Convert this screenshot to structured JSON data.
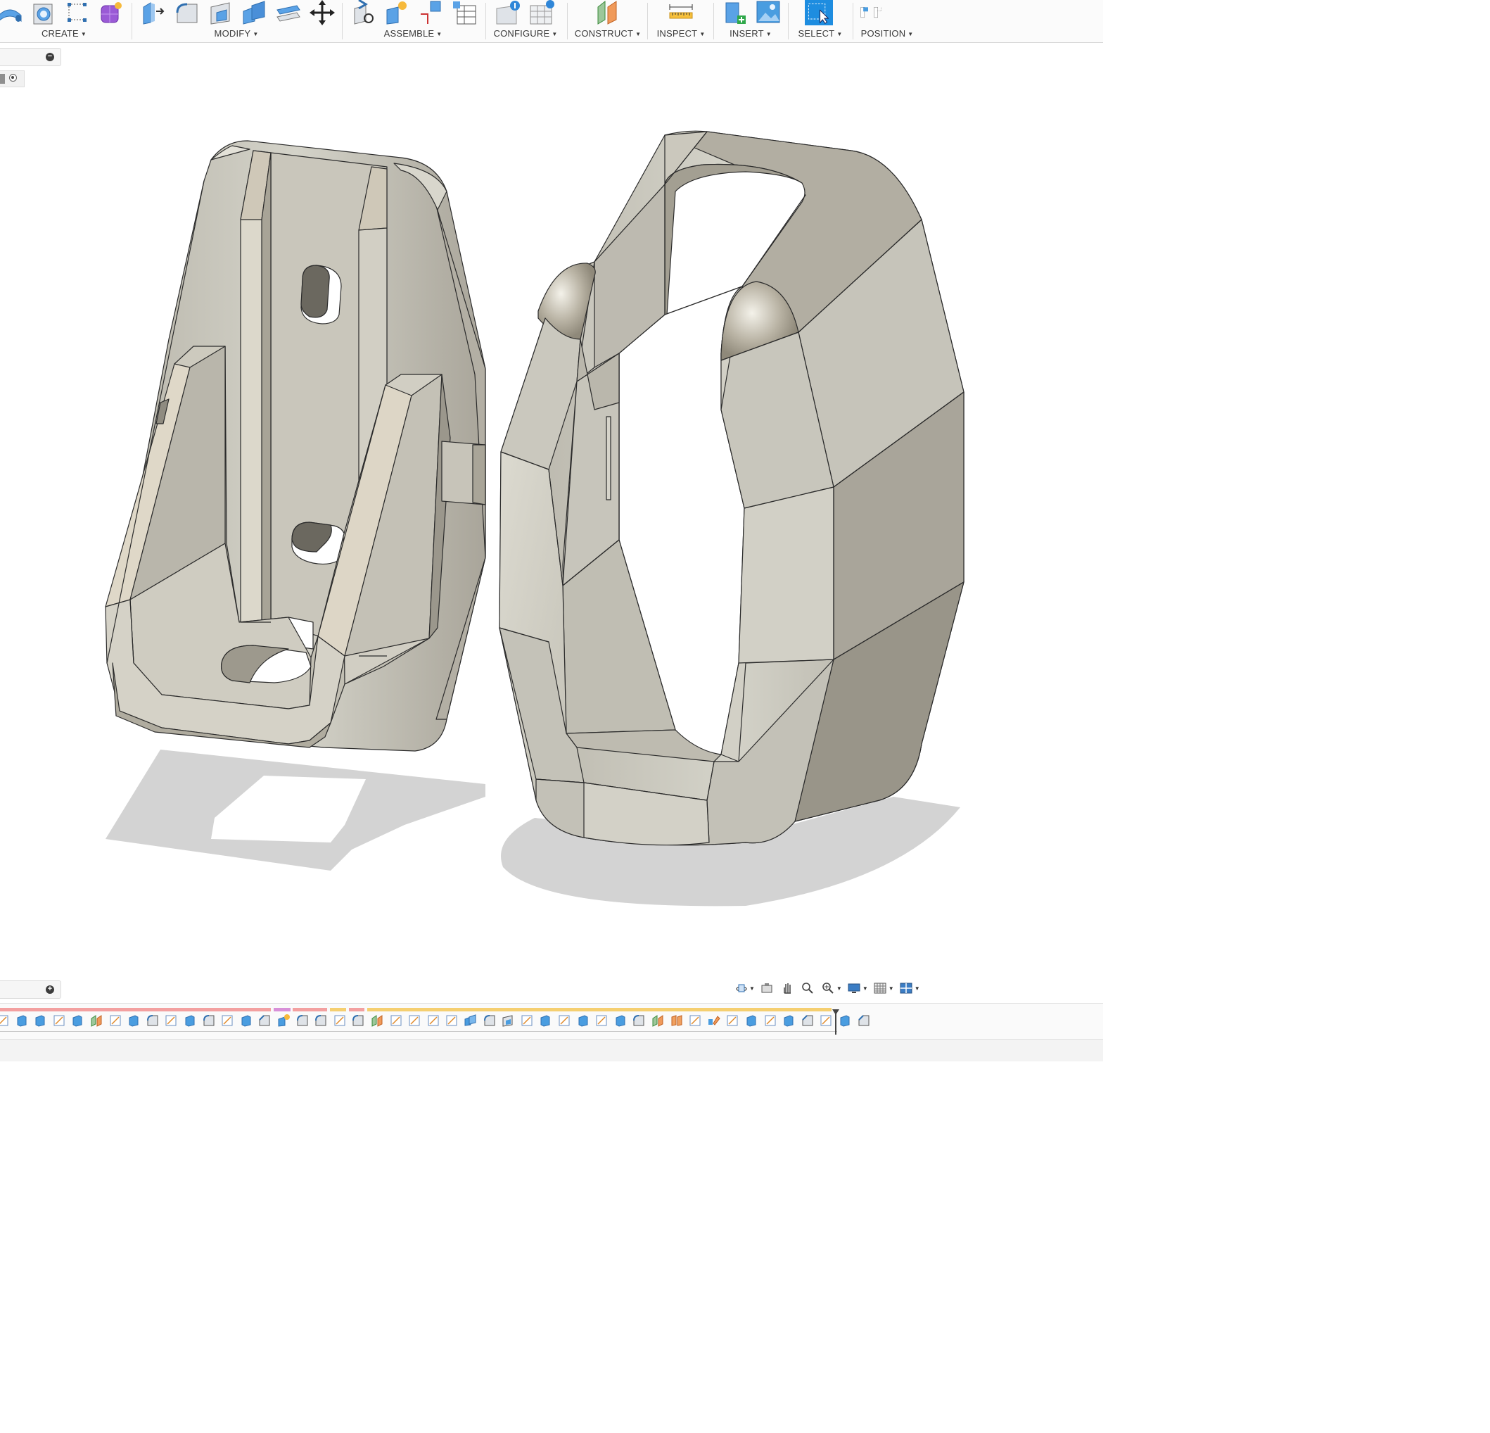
{
  "toolbar": {
    "groups": [
      {
        "label": "CREATE",
        "icons": [
          "create-pipe-icon",
          "create-hole-icon",
          "create-sketch-dimension-icon",
          "create-form-icon"
        ]
      },
      {
        "label": "MODIFY",
        "icons": [
          "press-pull-icon",
          "fillet-icon",
          "shell-icon",
          "combine-icon",
          "offset-face-icon",
          "move-copy-icon"
        ]
      },
      {
        "label": "ASSEMBLE",
        "icons": [
          "new-component-icon",
          "joint-icon",
          "as-built-joint-icon",
          "joint-table-icon"
        ]
      },
      {
        "label": "CONFIGURE",
        "icons": [
          "configure-icon",
          "configure-table-icon"
        ]
      },
      {
        "label": "CONSTRUCT",
        "icons": [
          "offset-plane-icon"
        ]
      },
      {
        "label": "INSPECT",
        "icons": [
          "measure-icon"
        ]
      },
      {
        "label": "INSERT",
        "icons": [
          "insert-derive-icon",
          "insert-canvas-icon"
        ]
      },
      {
        "label": "SELECT",
        "icons": [
          "select-icon"
        ]
      },
      {
        "label": "POSITION",
        "icons": [
          "capture-position-icon"
        ]
      }
    ]
  },
  "browser": {
    "collapse_symbol": "−",
    "expand_symbol": "+"
  },
  "viewport": {
    "bodies": [
      "bracket-body",
      "loop-clip-body"
    ],
    "body_color": "#c9c7bd",
    "shadow_color": "#d3d3d3"
  },
  "navbar": {
    "tools": [
      "orbit-icon",
      "look-at-icon",
      "pan-icon",
      "zoom-icon",
      "fit-icon",
      "display-settings-icon",
      "grid-settings-icon",
      "viewports-icon"
    ]
  },
  "timeline": {
    "segment_colors": [
      "#f3a0a0",
      "#d890d8",
      "#f3a0a0",
      "#f5cf70",
      "#f3a0a0",
      "#f5cf70"
    ],
    "feature_types": [
      "sketch",
      "extrude",
      "extrude",
      "sketch",
      "extrude",
      "plane",
      "sketch",
      "extrude",
      "fillet",
      "sketch",
      "extrude",
      "fillet",
      "sketch",
      "extrude",
      "chamfer",
      "joint",
      "fillet",
      "fillet",
      "sketch",
      "fillet",
      "plane",
      "sketch",
      "sketch",
      "sketch",
      "sketch",
      "combine",
      "fillet",
      "shell",
      "sketch",
      "extrude",
      "sketch",
      "extrude",
      "sketch",
      "extrude",
      "fillet",
      "plane",
      "mirror",
      "sketch",
      "pattern",
      "sketch",
      "extrude",
      "sketch",
      "extrude",
      "chamfer",
      "sketch",
      "extrude",
      "chamfer"
    ]
  }
}
